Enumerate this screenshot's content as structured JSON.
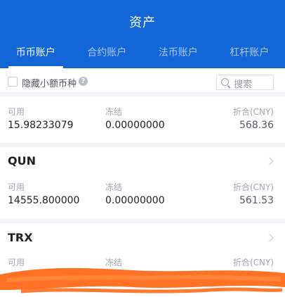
{
  "header": {
    "title": "资产"
  },
  "tabs": [
    {
      "label": "币币账户",
      "active": true
    },
    {
      "label": "合约账户",
      "active": false
    },
    {
      "label": "法币账户",
      "active": false
    },
    {
      "label": "杠杆账户",
      "active": false
    }
  ],
  "filter": {
    "hide_small_label": "隐藏小额币种",
    "help_icon": "?",
    "search_placeholder": "搜索"
  },
  "columns": {
    "available": "可用",
    "frozen": "冻结",
    "converted": "折合(CNY)"
  },
  "assets": [
    {
      "name": "",
      "available": "15.98233079",
      "frozen": "0.00000000",
      "converted": "568.36"
    },
    {
      "name": "QUN",
      "available": "14555.800000",
      "frozen": "0.00000000",
      "converted": "561.53"
    },
    {
      "name": "TRX",
      "available": "",
      "frozen": "",
      "converted": ""
    }
  ],
  "colors": {
    "header_blue": "#1366d6",
    "redaction_orange": "#ff6a1a"
  }
}
